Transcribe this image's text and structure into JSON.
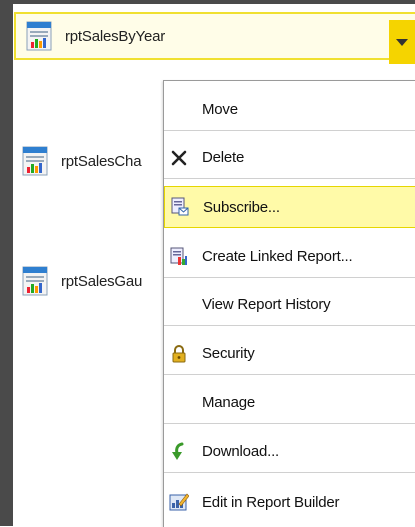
{
  "reports": [
    {
      "name": "rptSalesByYear",
      "icon": "report-icon"
    },
    {
      "name": "rptSalesCha",
      "icon": "report-icon"
    },
    {
      "name": "rptSalesGau",
      "icon": "report-icon"
    }
  ],
  "menu": {
    "items": [
      {
        "label": "Move",
        "icon": ""
      },
      {
        "label": "Delete",
        "icon": "delete-x-icon"
      },
      {
        "label": "Subscribe...",
        "icon": "subscribe-icon",
        "highlighted": true
      },
      {
        "label": "Create Linked Report...",
        "icon": "linked-report-icon"
      },
      {
        "label": "View Report History",
        "icon": ""
      },
      {
        "label": "Security",
        "icon": "lock-icon"
      },
      {
        "label": "Manage",
        "icon": ""
      },
      {
        "label": "Download...",
        "icon": "download-arrow-icon"
      },
      {
        "label": "Edit in Report Builder",
        "icon": "report-builder-icon"
      }
    ]
  },
  "colors": {
    "selection_border": "#f0e030",
    "dropdown_button": "#f5d400",
    "menu_highlight": "#fffaa8",
    "frame": "#4a4a4a"
  }
}
